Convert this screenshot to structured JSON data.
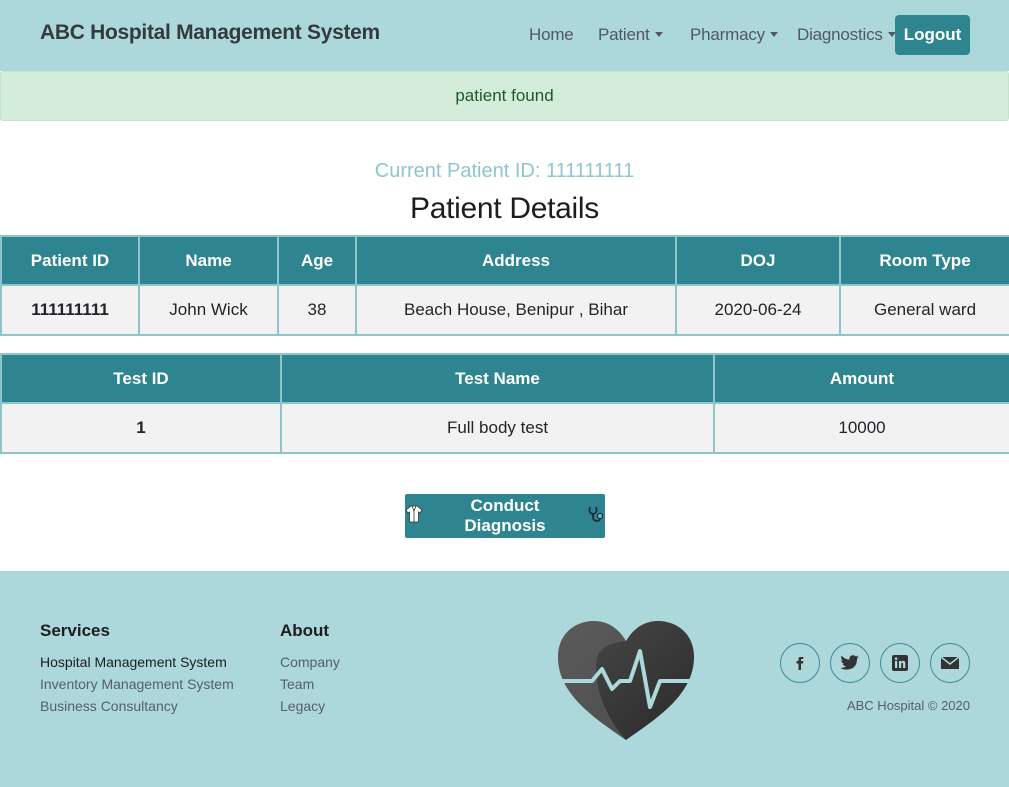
{
  "navbar": {
    "brand": "ABC Hospital Management System",
    "links": {
      "home": "Home",
      "patient": "Patient",
      "pharmacy": "Pharmacy",
      "diagnostics": "Diagnostics"
    },
    "logout": "Logout"
  },
  "alert": {
    "message": "patient found"
  },
  "current_patient": {
    "label": "Current Patient ID: 111111111"
  },
  "page_title": "Patient Details",
  "patient_table": {
    "headers": [
      "Patient ID",
      "Name",
      "Age",
      "Address",
      "DOJ",
      "Room Type"
    ],
    "row": [
      "111111111",
      "John Wick",
      "38",
      "Beach House, Benipur , Bihar",
      "2020-06-24",
      "General ward"
    ]
  },
  "test_table": {
    "headers": [
      "Test ID",
      "Test Name",
      "Amount"
    ],
    "row": [
      "1",
      "Full body test",
      "10000"
    ]
  },
  "diagnosis_button": {
    "label": "Conduct Diagnosis"
  },
  "footer": {
    "services": {
      "heading": "Services",
      "links": [
        "Hospital Management System",
        "Inventory Management System",
        "Business Consultancy"
      ]
    },
    "about": {
      "heading": "About",
      "links": [
        "Company",
        "Team",
        "Legacy"
      ]
    },
    "social_icons": [
      "facebook-icon",
      "twitter-icon",
      "linkedin-icon",
      "email-icon"
    ],
    "copyright": "ABC Hospital © 2020"
  },
  "colors": {
    "header_bg": "#acd8dc",
    "accent": "#2e8590",
    "alert_bg": "#d4ecda",
    "table_border": "#8dc5cb"
  }
}
